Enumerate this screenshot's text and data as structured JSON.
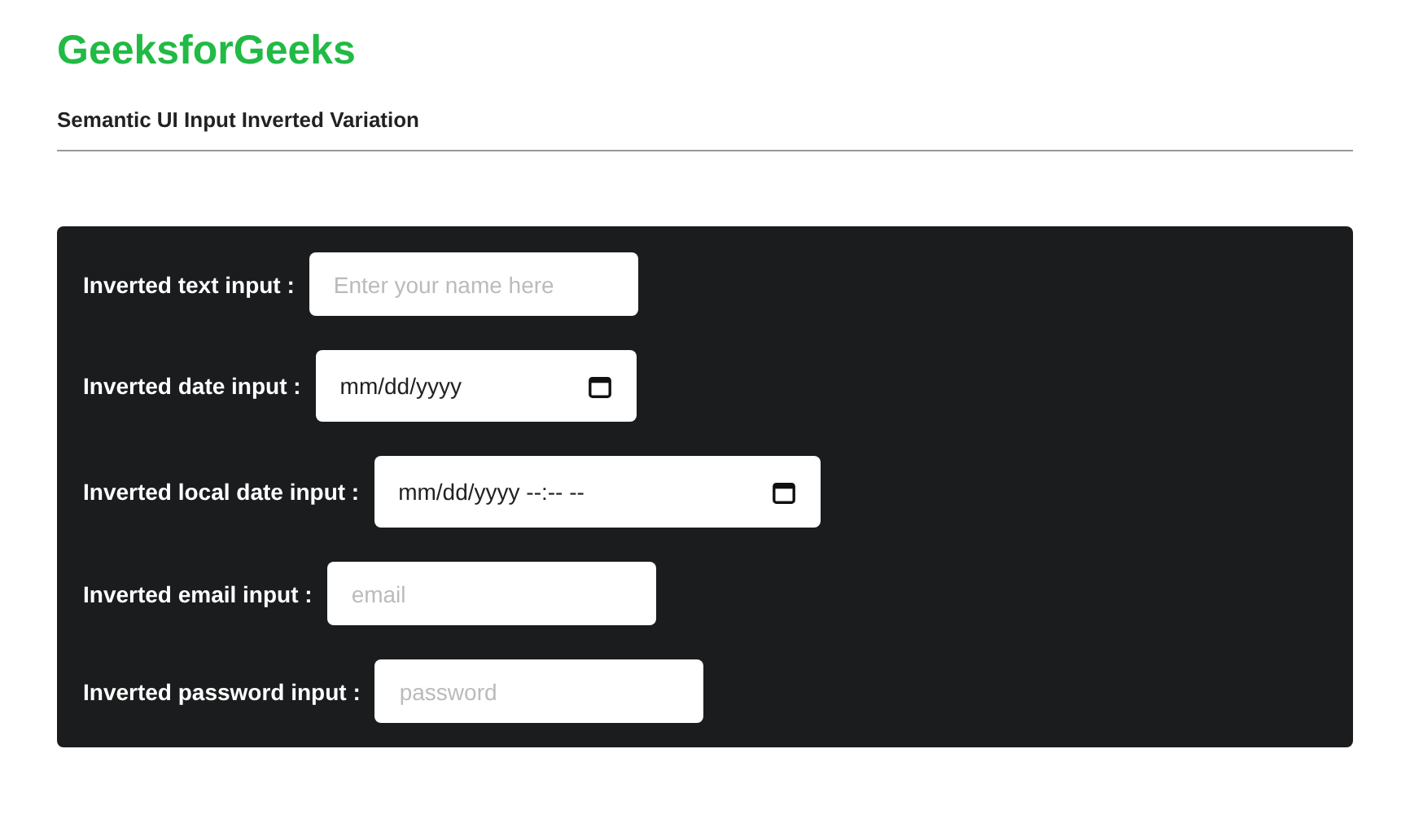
{
  "header": {
    "title": "GeeksforGeeks",
    "subtitle": "Semantic UI Input Inverted Variation"
  },
  "fields": [
    {
      "kind": "text",
      "label": "Inverted text input :",
      "placeholder": "Enter your name here"
    },
    {
      "kind": "date",
      "label": "Inverted date input :",
      "value": "mm/dd/yyyy"
    },
    {
      "kind": "datetime",
      "label": "Inverted local date input :",
      "value": "mm/dd/yyyy --:-- --"
    },
    {
      "kind": "email",
      "label": "Inverted email input :",
      "placeholder": "email"
    },
    {
      "kind": "password",
      "label": "Inverted password input :",
      "placeholder": "password"
    }
  ]
}
